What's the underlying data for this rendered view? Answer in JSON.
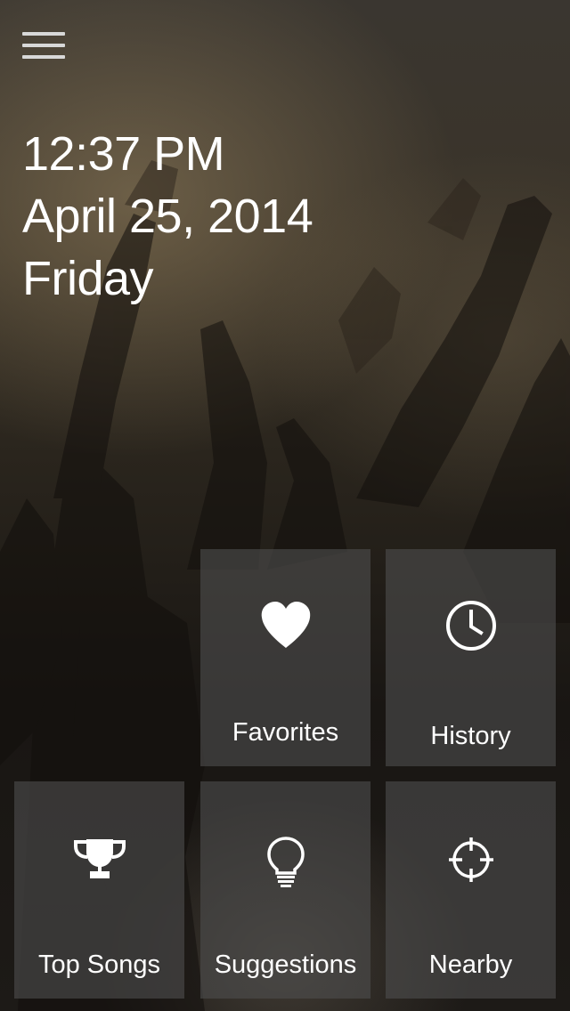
{
  "header": {
    "menu_icon": "hamburger-menu-icon"
  },
  "clock": {
    "time": "12:37 PM",
    "date": "April 25, 2014",
    "weekday": "Friday"
  },
  "tiles": {
    "favorites": {
      "label": "Favorites",
      "icon": "heart-icon"
    },
    "history": {
      "label": "History",
      "icon": "clock-icon"
    },
    "top_songs": {
      "label": "Top Songs",
      "icon": "trophy-icon"
    },
    "suggestions": {
      "label": "Suggestions",
      "icon": "lightbulb-icon"
    },
    "nearby": {
      "label": "Nearby",
      "icon": "crosshair-icon"
    }
  },
  "colors": {
    "tile_background": "#4e4e4e",
    "text": "#ffffff"
  }
}
